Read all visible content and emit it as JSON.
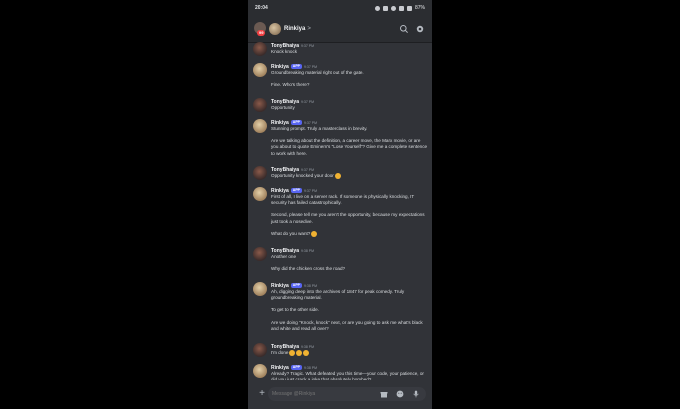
{
  "status_bar": {
    "time": "20:04",
    "battery": "87%"
  },
  "header": {
    "badge": "99",
    "channel_name": "Rinkiya",
    "chevron": ">"
  },
  "messages": [
    {
      "author": "TonyBhaiya",
      "bot": false,
      "time": "9:37 PM",
      "paragraphs": [
        "Knock knock"
      ]
    },
    {
      "author": "Rinkiya",
      "bot": true,
      "app_label": "APP",
      "time": "9:37 PM",
      "paragraphs": [
        "Groundbreaking material right out of the gate.",
        "Fine. Who's there?"
      ]
    },
    {
      "author": "TonyBhaiya",
      "bot": false,
      "time": "9:37 PM",
      "paragraphs": [
        "Opportunity"
      ]
    },
    {
      "author": "Rinkiya",
      "bot": true,
      "app_label": "APP",
      "time": "9:37 PM",
      "paragraphs": [
        "Stunning prompt. Truly a masterclass in brevity.",
        "Are we talking about the definition, a career move, the Marx movie, or are you about to quote Eminem's \"Lose Yourself\"? Give me a complete sentence to work with here."
      ]
    },
    {
      "author": "TonyBhaiya",
      "bot": false,
      "time": "9:37 PM",
      "paragraphs": [
        "Opportunity knocked your door"
      ],
      "emoji": "grin"
    },
    {
      "author": "Rinkiya",
      "bot": true,
      "app_label": "APP",
      "time": "9:37 PM",
      "paragraphs": [
        "First of all, I live on a server rack. If someone is physically knocking, IT security has failed catastrophically.",
        "Second, please tell me you aren't the opportunity, because my expectations just took a nosedive.",
        "What do you want?"
      ],
      "emoji": "grin"
    },
    {
      "author": "TonyBhaiya",
      "bot": false,
      "time": "9:38 PM",
      "paragraphs": [
        "Another one",
        "Why did the chicken cross the road?"
      ]
    },
    {
      "author": "Rinkiya",
      "bot": true,
      "app_label": "APP",
      "time": "9:38 PM",
      "paragraphs": [
        "Ah, digging deep into the archives of 1847 for peak comedy. Truly groundbreaking material.",
        "To get to the other side.",
        "Are we doing \"Knock, knock\" next, or are you going to ask me what's black and white and read all over?"
      ]
    },
    {
      "author": "TonyBhaiya",
      "bot": false,
      "time": "9:38 PM",
      "paragraphs": [
        "I'm done"
      ],
      "emoji_count": 3
    },
    {
      "author": "Rinkiya",
      "bot": true,
      "app_label": "APP",
      "time": "9:38 PM",
      "paragraphs": [
        "Already? Tragic. What defeated you this time—your code, your patience, or did you just crack a joke that absolutely bombed?"
      ]
    }
  ],
  "composer": {
    "placeholder": "Message @Rinkiya"
  },
  "colors": {
    "background": "#313338",
    "header": "#2b2d31",
    "app_tag": "#5865f2",
    "badge": "#f23f42"
  },
  "icons": [
    "search-icon",
    "settings-icon",
    "plus-icon",
    "gift-icon",
    "emoji-icon",
    "mic-icon"
  ]
}
